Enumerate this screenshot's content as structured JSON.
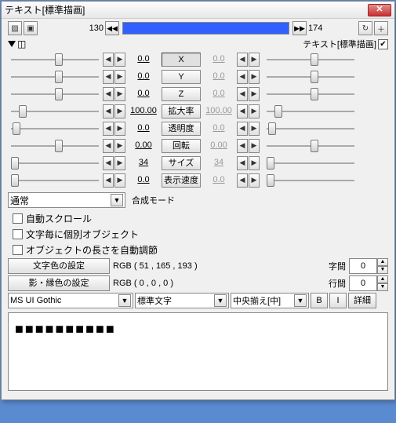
{
  "title": "テキスト[標準描画]",
  "timeline": {
    "start": "130",
    "end": "174"
  },
  "subheader": {
    "label": "テキスト[標準描画]"
  },
  "params": [
    {
      "label": "X",
      "v1": "0.0",
      "v2": "0.0",
      "v2gray": true,
      "t1": 50,
      "t2": 50,
      "pressed": true
    },
    {
      "label": "Y",
      "v1": "0.0",
      "v2": "0.0",
      "v2gray": true,
      "t1": 50,
      "t2": 50
    },
    {
      "label": "Z",
      "v1": "0.0",
      "v2": "0.0",
      "v2gray": true,
      "t1": 50,
      "t2": 50
    },
    {
      "label": "拡大率",
      "v1": "100.00",
      "v2": "100.00",
      "v2gray": true,
      "t1": 12,
      "t2": 12
    },
    {
      "label": "透明度",
      "v1": "0.0",
      "v2": "0.0",
      "v2gray": true,
      "t1": 5,
      "t2": 5
    },
    {
      "label": "回転",
      "v1": "0.00",
      "v2": "0.00",
      "v2gray": true,
      "t1": 50,
      "t2": 50
    },
    {
      "label": "サイズ",
      "v1": "34",
      "v2": "34",
      "v2gray": true,
      "t1": 3,
      "t2": 3
    },
    {
      "label": "表示速度",
      "v1": "0.0",
      "v2": "0.0",
      "v2gray": true,
      "t1": 3,
      "t2": 3
    }
  ],
  "compose": {
    "mode": "通常",
    "label": "合成モード"
  },
  "checks": {
    "autoscroll": "自動スクロール",
    "perchar": "文字毎に個別オブジェクト",
    "autolen": "オブジェクトの長さを自動調節"
  },
  "color1": {
    "btn": "文字色の設定",
    "rgb": "RGB ( 51 , 165 , 193 )"
  },
  "color2": {
    "btn": "影・縁色の設定",
    "rgb": "RGB ( 0 , 0 , 0 )"
  },
  "spacing": {
    "char_label": "字間",
    "char": "0",
    "line_label": "行間",
    "line": "0"
  },
  "font": {
    "name": "MS UI Gothic",
    "style": "標準文字",
    "align": "中央揃え[中]",
    "b": "B",
    "i": "I",
    "detail": "詳細"
  },
  "text": "■■■■■■■■■■"
}
